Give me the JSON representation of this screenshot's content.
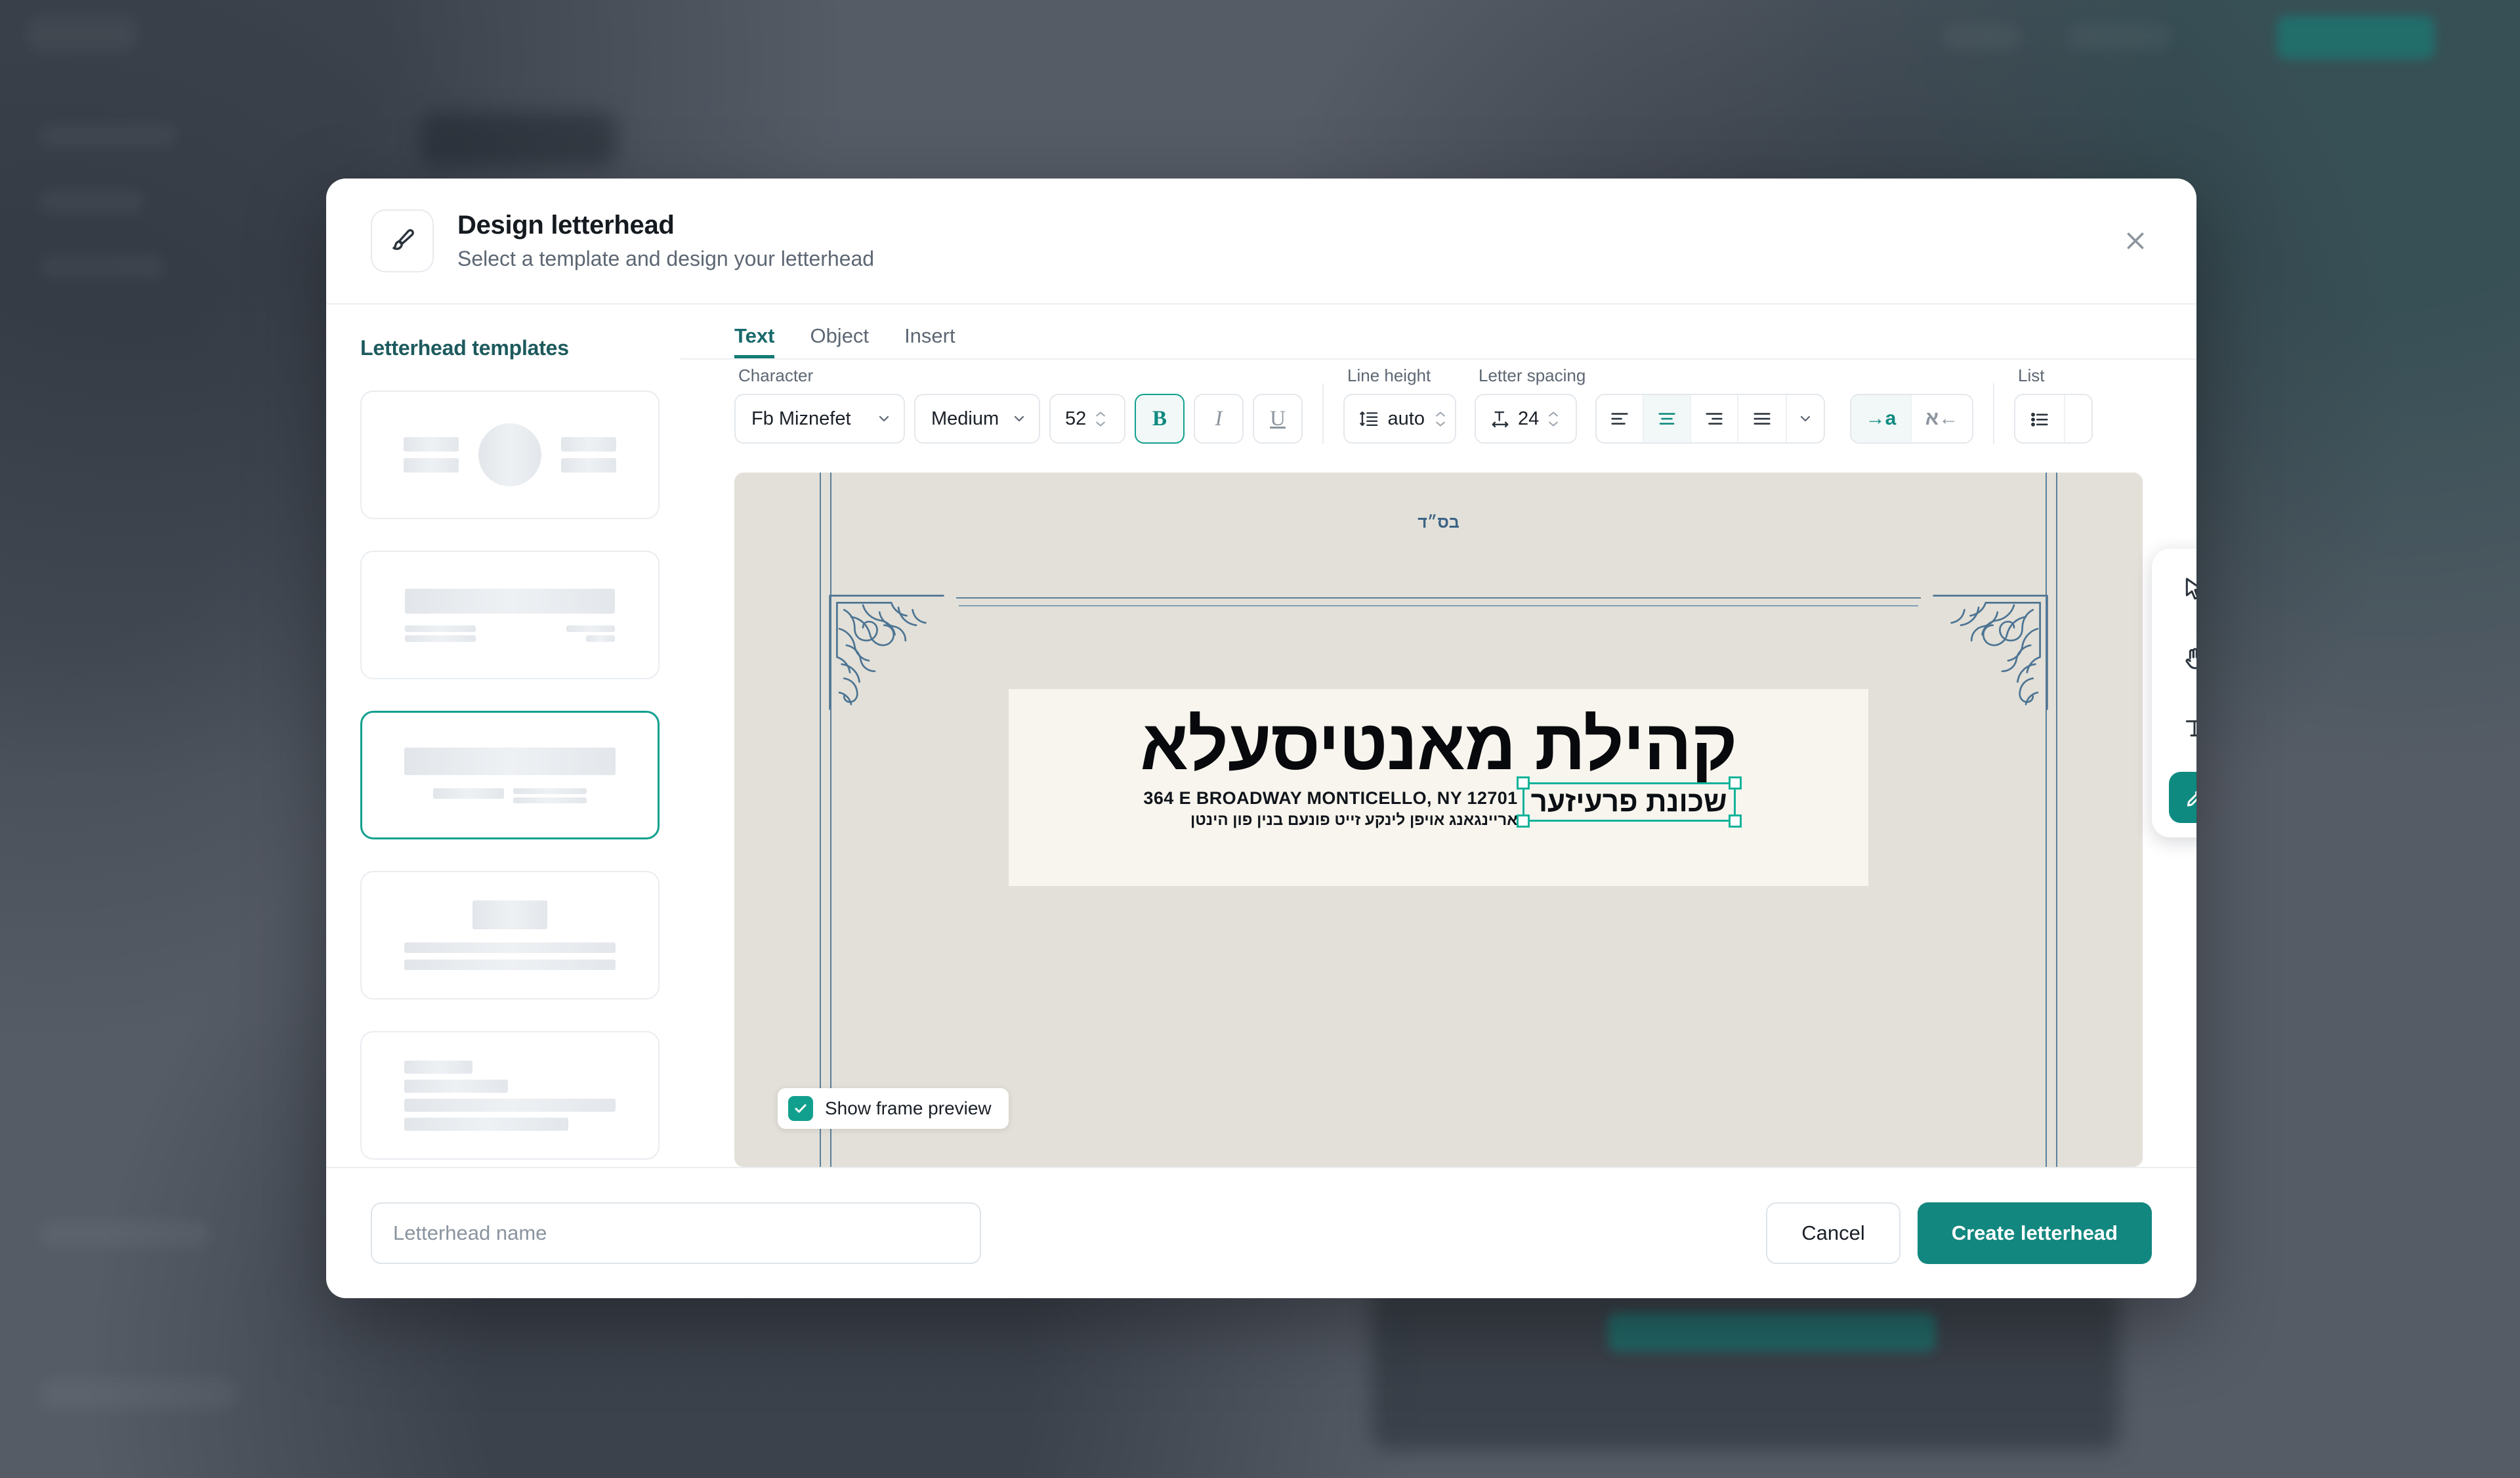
{
  "dialog": {
    "title": "Design letterhead",
    "subtitle": "Select a template and design your letterhead",
    "brush_icon": "paintbrush-icon",
    "close_icon": "close-icon"
  },
  "templates_pane": {
    "title": "Letterhead templates",
    "selected_index": 2,
    "items": [
      {
        "layout": "logo-center-two-columns"
      },
      {
        "layout": "wide-banner-with-two-caption-rows"
      },
      {
        "layout": "wide-banner-with-centered-captions"
      },
      {
        "layout": "small-centered-block-two-bars"
      },
      {
        "layout": "stacked-left-bars"
      },
      {
        "layout": "multi-line-paragraph-with-side-block"
      },
      {
        "layout": "partial-bottom-card"
      }
    ]
  },
  "tabs": {
    "active": "Text",
    "items": [
      {
        "label": "Text"
      },
      {
        "label": "Object"
      },
      {
        "label": "Insert"
      }
    ]
  },
  "toolbar": {
    "character": {
      "label": "Character",
      "font_family": "Fb Miznefet",
      "font_weight": "Medium",
      "font_size": "52",
      "bold": {
        "label": "B",
        "active": true
      },
      "italic": {
        "label": "I",
        "active": false
      },
      "underline": {
        "label": "U",
        "active": false
      }
    },
    "line_height": {
      "label": "Line height",
      "value": "auto",
      "icon": "line-height-icon"
    },
    "letter_spacing": {
      "label": "Letter spacing",
      "value": "24",
      "icon": "letter-spacing-icon"
    },
    "align": {
      "active": "center",
      "options": [
        "left",
        "center",
        "right",
        "justify"
      ]
    },
    "direction": {
      "active": "ltr",
      "ltr_label": "→a",
      "rtl_label": "א←"
    },
    "list": {
      "label": "List",
      "icon": "bullet-list-icon"
    }
  },
  "canvas": {
    "bsd": "בס״ד",
    "title": "קהילת מאנטיסעלא",
    "neighborhood": "שכונת פרעיזער",
    "address_en": "364 E BROADWAY MONTICELLO, NY 12701",
    "address_yi": "אריינגאנג אויפן לינקע זייט פונעם בנין פון הינטן",
    "frame_preview": {
      "label": "Show frame preview",
      "checked": true
    },
    "selected_element": "neighborhood-text"
  },
  "tool_palette": {
    "active": "eyedropper",
    "tools": [
      {
        "name": "select-cursor-icon"
      },
      {
        "name": "hand-pan-icon"
      },
      {
        "name": "text-tool-icon"
      },
      {
        "name": "eyedropper-icon"
      }
    ]
  },
  "footer": {
    "name_placeholder": "Letterhead name",
    "name_value": "",
    "cancel_label": "Cancel",
    "create_label": "Create letterhead"
  },
  "colors": {
    "accent_teal": "#12877f",
    "accent_teal_bright": "#12a08e",
    "selection_teal": "#12b39a",
    "tab_active": "#18696b",
    "canvas_bg": "#e2e0d8",
    "letterhead_bg": "#f8f5ee",
    "frame_blue": "#5b7f9d",
    "overlay": "#565c66"
  }
}
